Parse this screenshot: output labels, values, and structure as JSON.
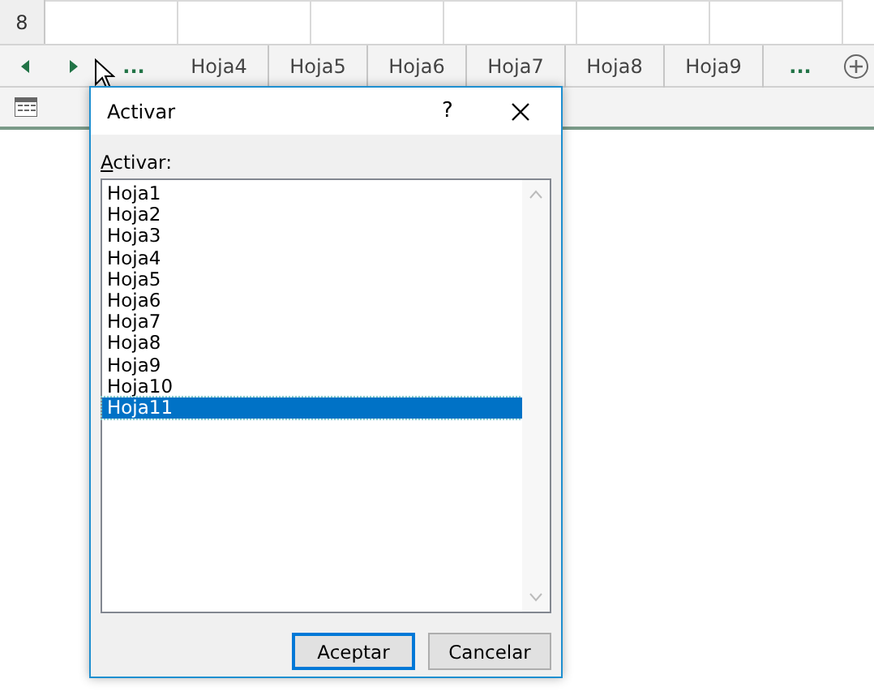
{
  "sheet": {
    "row_header": "8"
  },
  "sheet_tabs": {
    "left_ellipsis": "...",
    "tabs": [
      "Hoja4",
      "Hoja5",
      "Hoja6",
      "Hoja7",
      "Hoja8",
      "Hoja9"
    ],
    "right_ellipsis": "..."
  },
  "dialog": {
    "title": "Activar",
    "help": "?",
    "label": "Activar:",
    "items": [
      {
        "label": "Hoja1",
        "selected": false
      },
      {
        "label": "Hoja2",
        "selected": false
      },
      {
        "label": "Hoja3",
        "selected": false
      },
      {
        "label": "Hoja4",
        "selected": false
      },
      {
        "label": "Hoja5",
        "selected": false
      },
      {
        "label": "Hoja6",
        "selected": false
      },
      {
        "label": "Hoja7",
        "selected": false
      },
      {
        "label": "Hoja8",
        "selected": false
      },
      {
        "label": "Hoja9",
        "selected": false
      },
      {
        "label": "Hoja10",
        "selected": false
      },
      {
        "label": "Hoja11",
        "selected": true
      }
    ],
    "buttons": [
      {
        "label": "Aceptar",
        "default": true
      },
      {
        "label": "Cancelar",
        "default": false
      }
    ]
  }
}
